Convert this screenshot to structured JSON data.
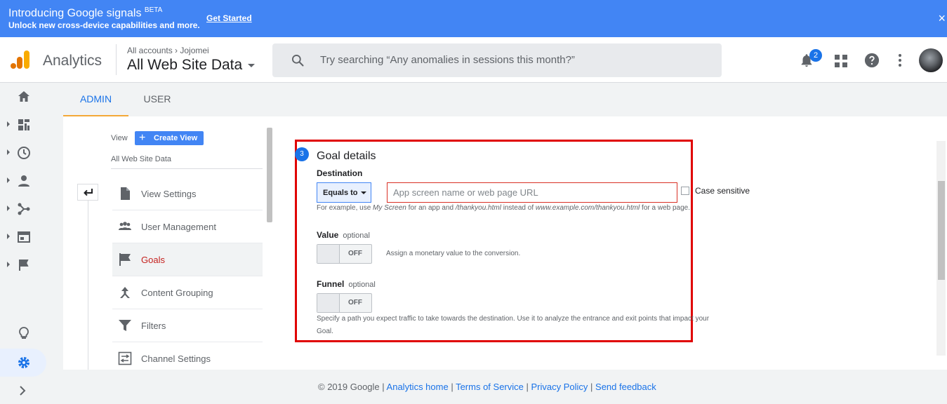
{
  "banner": {
    "title": "Introducing Google signals",
    "badge": "BETA",
    "subtitle": "Unlock new cross-device capabilities and more.",
    "cta": "Get Started",
    "close_glyph": "×"
  },
  "header": {
    "app_name": "Analytics",
    "breadcrumb": "All accounts  ›  Jojomei",
    "property": "All Web Site Data",
    "search_placeholder": "Try searching “Any anomalies in sessions this month?”",
    "notification_count": "2"
  },
  "tabs": [
    {
      "label": "ADMIN",
      "active": true
    },
    {
      "label": "USER",
      "active": false
    }
  ],
  "view_panel": {
    "view_label": "View",
    "create_view": "Create View",
    "view_name": "All Web Site Data",
    "items": [
      {
        "label": "View Settings",
        "icon": "document-icon"
      },
      {
        "label": "User Management",
        "icon": "people-icon"
      },
      {
        "label": "Goals",
        "icon": "flag-icon",
        "active": true
      },
      {
        "label": "Content Grouping",
        "icon": "content-grouping-icon"
      },
      {
        "label": "Filters",
        "icon": "filter-icon"
      },
      {
        "label": "Channel Settings",
        "icon": "channel-settings-icon"
      }
    ]
  },
  "goal": {
    "step": "3",
    "title": "Goal details",
    "destination_label": "Destination",
    "match_type": "Equals to",
    "destination_placeholder": "App screen name or web page URL",
    "case_sensitive": "Case sensitive",
    "dest_hint": {
      "a": "For example, use ",
      "b": "My Screen",
      "c": " for an app and ",
      "d": "/thankyou.html",
      "e": " instead of ",
      "f": "www.example.com/thankyou.html",
      "g": " for a web page."
    },
    "value_label": "Value",
    "optional": "optional",
    "value_toggle": "OFF",
    "value_hint": "Assign a monetary value to the conversion.",
    "funnel_label": "Funnel",
    "funnel_toggle": "OFF",
    "funnel_hint_line1": "Specify a path you expect traffic to take towards the destination. Use it to analyze the entrance and exit points that impact your",
    "funnel_hint_line2": "Goal."
  },
  "footer": {
    "copyright": "© 2019 Google",
    "sep": " | ",
    "links": [
      "Analytics home",
      "Terms of Service",
      "Privacy Policy",
      "Send feedback"
    ]
  },
  "colors": {
    "banner": "#4285f4",
    "accent": "#1a73e8",
    "highlight_border": "#e00000",
    "tab_underline": "#f4a837"
  }
}
